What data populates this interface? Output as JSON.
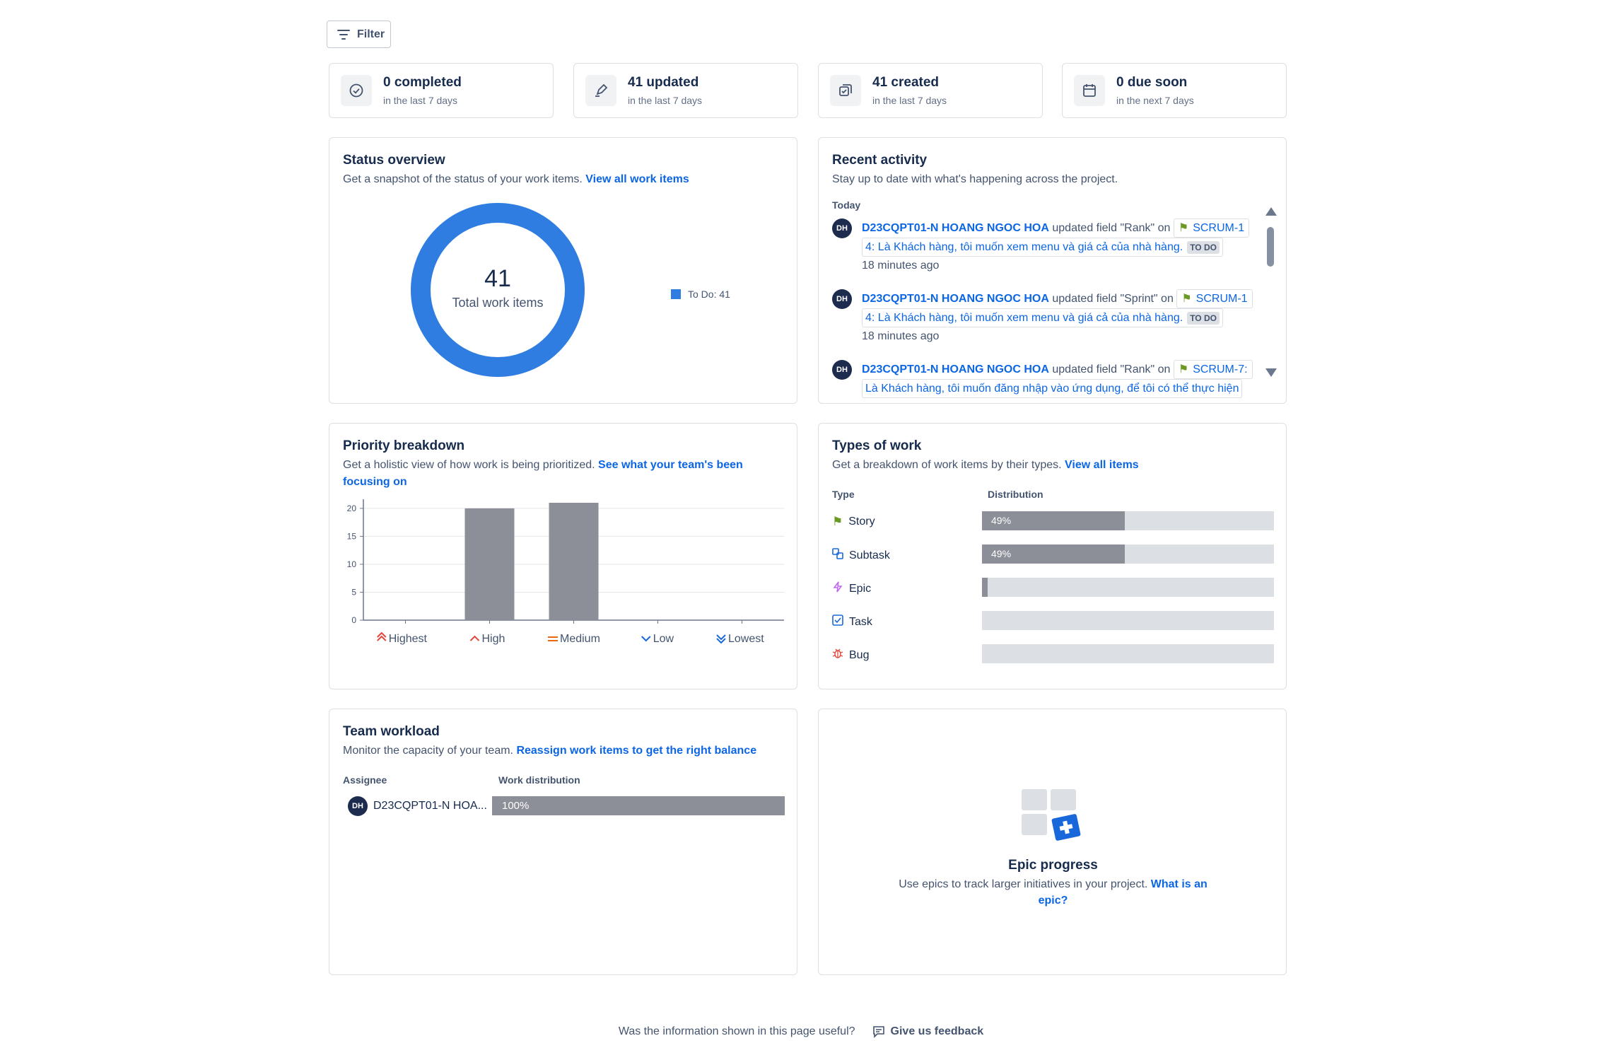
{
  "filter": {
    "label": "Filter"
  },
  "stats": [
    {
      "main": "0 completed",
      "sub": "in the last 7 days",
      "icon": "check-circle-icon"
    },
    {
      "main": "41 updated",
      "sub": "in the last 7 days",
      "icon": "edit-icon"
    },
    {
      "main": "41 created",
      "sub": "in the last 7 days",
      "icon": "create-icon"
    },
    {
      "main": "0 due soon",
      "sub": "in the next 7 days",
      "icon": "calendar-icon"
    }
  ],
  "status": {
    "title": "Status overview",
    "desc": "Get a snapshot of the status of your work items.",
    "link": "View all work items",
    "total": "41",
    "total_label": "Total work items",
    "legend": "To Do: 41",
    "color": "#2f7de1"
  },
  "activity": {
    "title": "Recent activity",
    "desc": "Stay up to date with what's happening across the project.",
    "today": "Today",
    "items": [
      {
        "initials": "DH",
        "user": "D23CQPT01-N HOANG NGOC HOA",
        "action": "updated field \"Rank\" on",
        "ref": "SCRUM-1",
        "ref2": "4: Là Khách hàng, tôi muốn xem menu và giá cả của nhà hàng.",
        "status": "TO DO",
        "time": "18 minutes ago"
      },
      {
        "initials": "DH",
        "user": "D23CQPT01-N HOANG NGOC HOA",
        "action": "updated field \"Sprint\" on",
        "ref": "SCRUM-1",
        "ref2": "4: Là Khách hàng, tôi muốn xem menu và giá cả của nhà hàng.",
        "status": "TO DO",
        "time": "18 minutes ago"
      },
      {
        "initials": "DH",
        "user": "D23CQPT01-N HOANG NGOC HOA",
        "action": "updated field \"Rank\" on",
        "ref": "SCRUM-7:",
        "ref2": "Là Khách hàng, tôi muốn đăng nhập vào ứng dụng, để tôi có thể thực hiện"
      }
    ]
  },
  "priority": {
    "title": "Priority breakdown",
    "desc": "Get a holistic view of how work is being prioritized.",
    "link_line1": "See what your team's been",
    "link_line2": "focusing on"
  },
  "chart_data": {
    "type": "bar",
    "categories": [
      "Highest",
      "High",
      "Medium",
      "Low",
      "Lowest"
    ],
    "values": [
      0,
      20,
      21,
      0,
      0
    ],
    "yticks": [
      "0",
      "5",
      "10",
      "15",
      "20"
    ],
    "ylim": [
      0,
      21
    ],
    "grid": true,
    "bar_color": "#8c8f97"
  },
  "types": {
    "title": "Types of work",
    "desc": "Get a breakdown of work items by their types.",
    "link": "View all items",
    "col_type": "Type",
    "col_dist": "Distribution",
    "rows": [
      {
        "label": "Story",
        "pct": "49%",
        "value": 0.49,
        "icon": "story-icon"
      },
      {
        "label": "Subtask",
        "pct": "49%",
        "value": 0.49,
        "icon": "subtask-icon"
      },
      {
        "label": "Epic",
        "pct": "",
        "value": 0.02,
        "icon": "epic-icon"
      },
      {
        "label": "Task",
        "pct": "",
        "value": 0,
        "icon": "task-icon"
      },
      {
        "label": "Bug",
        "pct": "",
        "value": 0,
        "icon": "bug-icon"
      }
    ]
  },
  "workload": {
    "title": "Team workload",
    "desc": "Monitor the capacity of your team.",
    "link": "Reassign work items to get the right balance",
    "col_assignee": "Assignee",
    "col_dist": "Work distribution",
    "initials": "DH",
    "assignee": "D23CQPT01-N HOA...",
    "pct": "100%",
    "value": 1.0
  },
  "epic": {
    "title": "Epic progress",
    "desc": "Use epics to track larger initiatives in your project.",
    "link_line1": "What is an",
    "link_line2": "epic?"
  },
  "footer": {
    "question": "Was the information shown in this page useful?",
    "feedback": "Give us feedback"
  }
}
